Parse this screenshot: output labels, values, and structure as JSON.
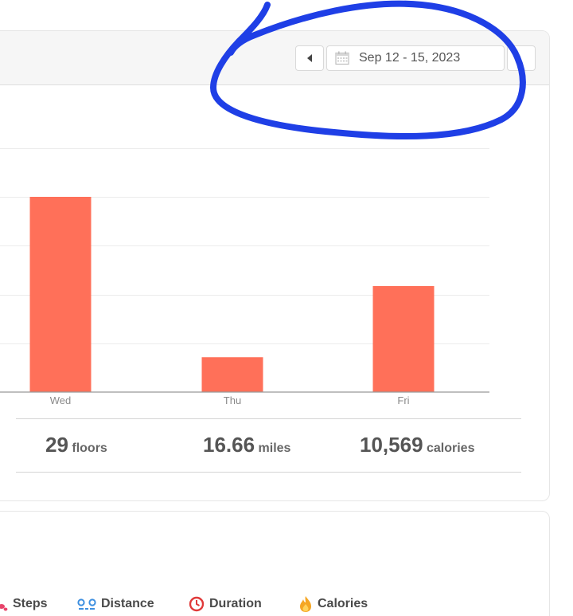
{
  "date_range": {
    "label": "Sep 12 - 15, 2023",
    "prev_icon": "triangle-left-icon",
    "calendar_icon": "calendar-icon"
  },
  "chart_data": {
    "type": "bar",
    "categories": [
      "Wed",
      "Thu",
      "Fri"
    ],
    "values": [
      28,
      5,
      15.2
    ],
    "ylim": [
      0,
      40
    ],
    "grid": true,
    "color": "#ff7059"
  },
  "stats": {
    "floors": {
      "value": "29",
      "unit": "floors"
    },
    "miles": {
      "value": "16.66",
      "unit": "miles"
    },
    "calories": {
      "value": "10,569",
      "unit": "calories"
    }
  },
  "legend": [
    {
      "label": "Steps",
      "icon": "footprints-icon",
      "color": "#e8436a"
    },
    {
      "label": "Distance",
      "icon": "route-pins-icon",
      "color": "#3d8fe0"
    },
    {
      "label": "Duration",
      "icon": "clock-icon",
      "color": "#e03a3a"
    },
    {
      "label": "Calories",
      "icon": "flame-icon",
      "color": "#f5a623"
    }
  ],
  "annotation": {
    "color": "#1f3fe6"
  }
}
